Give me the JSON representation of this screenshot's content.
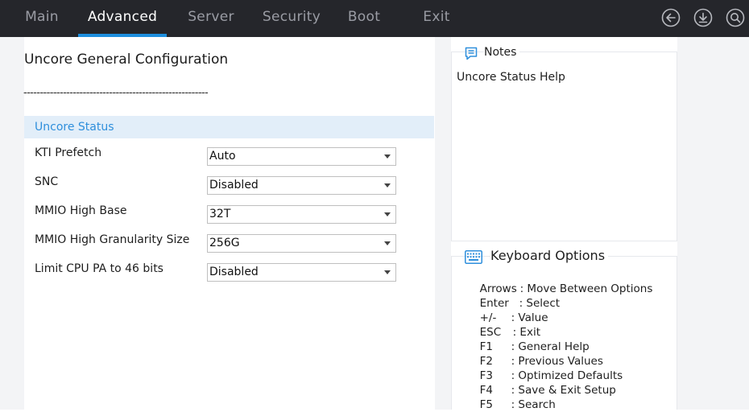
{
  "nav": {
    "tabs": [
      {
        "label": "Main",
        "active": false
      },
      {
        "label": "Advanced",
        "active": true
      },
      {
        "label": "Server",
        "active": false
      },
      {
        "label": "Security",
        "active": false
      },
      {
        "label": "Boot",
        "active": false
      },
      {
        "label": "Exit",
        "active": false
      }
    ],
    "icons": [
      "back-arrow-icon",
      "download-icon",
      "search-icon"
    ]
  },
  "page": {
    "title": "Uncore General Configuration",
    "separator": "--------------------------------------------------------",
    "section_header": "Uncore Status"
  },
  "settings": [
    {
      "label": "KTI Prefetch",
      "value": "Auto"
    },
    {
      "label": "SNC",
      "value": "Disabled"
    },
    {
      "label": "MMIO High Base",
      "value": "32T"
    },
    {
      "label": "MMIO High Granularity Size",
      "value": "256G"
    },
    {
      "label": "Limit CPU PA to 46 bits",
      "value": "Disabled"
    }
  ],
  "notes": {
    "title": "Notes",
    "text": "Uncore Status Help"
  },
  "keyboard": {
    "title": "Keyboard Options",
    "items": [
      {
        "key": "Arrows",
        "desc": ": Move Between Options"
      },
      {
        "key": "Enter",
        "desc": ": Select"
      },
      {
        "key": "+/-",
        "desc": ": Value"
      },
      {
        "key": "ESC",
        "desc": ": Exit"
      },
      {
        "key": "F1",
        "desc": ": General Help"
      },
      {
        "key": "F2",
        "desc": ": Previous Values"
      },
      {
        "key": "F3",
        "desc": ": Optimized Defaults"
      },
      {
        "key": "F4",
        "desc": ": Save & Exit Setup"
      },
      {
        "key": "F5",
        "desc": ": Search"
      }
    ]
  },
  "colors": {
    "topbar": "#25262b",
    "accent": "#1e8fde",
    "section_bg": "#e2eef9",
    "section_text": "#2f8fdc"
  }
}
